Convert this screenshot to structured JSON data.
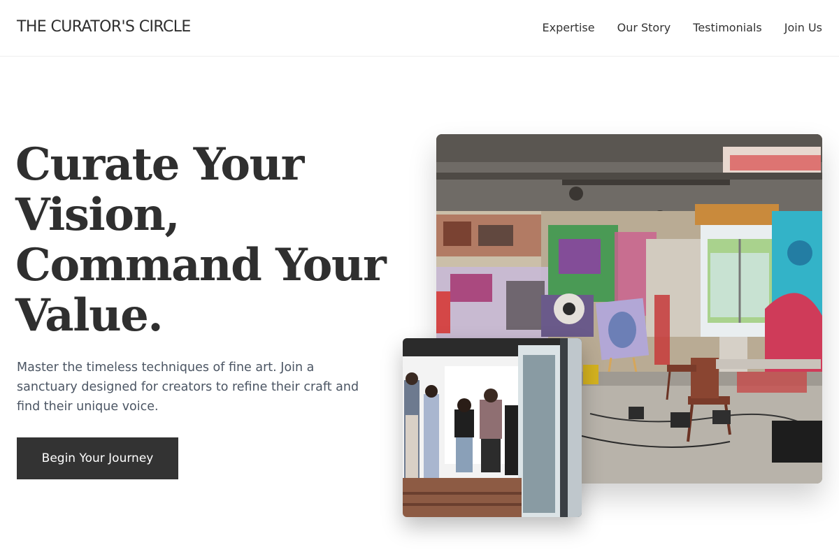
{
  "brand": {
    "name": "THE CURATOR'S CIRCLE"
  },
  "nav": {
    "items": [
      {
        "label": "Expertise"
      },
      {
        "label": "Our Story"
      },
      {
        "label": "Testimonials"
      },
      {
        "label": "Join Us"
      }
    ]
  },
  "hero": {
    "headline_lines": [
      "Curate Your",
      "Vision,",
      "Command Your",
      "Value."
    ],
    "subtext": "Master the timeless techniques of fine art. Join a sanctuary designed for creators to refine their craft and find their unique voice.",
    "cta_label": "Begin Your Journey"
  },
  "colors": {
    "text_dark": "#333333",
    "subtext": "#4b5563",
    "cta_background": "#333333",
    "cta_text": "#ffffff",
    "background": "#ffffff"
  }
}
